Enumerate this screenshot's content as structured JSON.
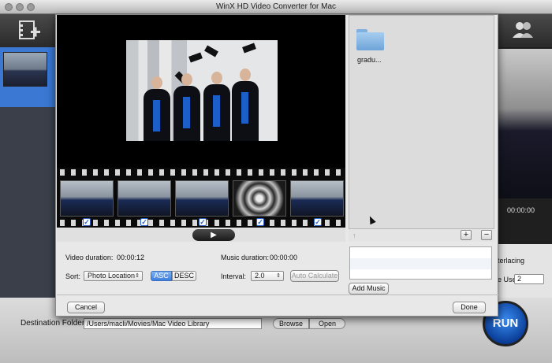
{
  "window": {
    "title": "WinX HD Video Converter for Mac"
  },
  "toolbar": {
    "add_photo_icon": "add-photo-icon",
    "users_icon": "users-icon"
  },
  "main": {
    "player_time": "00:00:00",
    "settings": {
      "interlacing_label": "terlacing",
      "core_use_label": "e Use:",
      "core_use_value": "2"
    },
    "destination": {
      "label": "Destination Folder:",
      "path": "/Users/macli/Movies/Mac Video Library",
      "browse_label": "Browse",
      "open_label": "Open"
    },
    "run_label": "RUN"
  },
  "sheet": {
    "filmstrip": {
      "frame_count": 5,
      "checked": [
        true,
        true,
        true,
        true,
        true
      ]
    },
    "controls": {
      "video_duration_label": "Video duration:",
      "video_duration_value": "00:00:12",
      "music_duration_label": "Music duration:",
      "music_duration_value": "00:00:00",
      "sort_label": "Sort:",
      "sort_value": "Photo Location",
      "asc_label": "ASC",
      "desc_label": "DESC",
      "interval_label": "Interval:",
      "interval_value": "2.0",
      "auto_calculate_label": "Auto Calculate"
    },
    "browser": {
      "folder_name": "gradu...",
      "add_symbol": "+",
      "remove_symbol": "−",
      "up_symbol": "↑"
    },
    "add_music_label": "Add Music",
    "cancel_label": "Cancel",
    "done_label": "Done"
  },
  "colors": {
    "accent": "#3c7fe0",
    "selection": "#3a78d4",
    "sheet_bg": "#e8e8e8"
  }
}
